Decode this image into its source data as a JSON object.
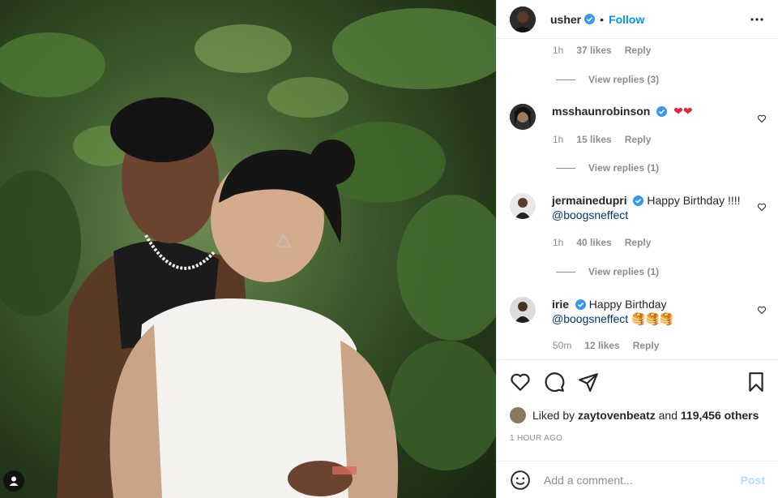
{
  "header": {
    "username": "usher",
    "separator": "•",
    "follow_label": "Follow",
    "more_icon": "more-horizontal-icon"
  },
  "top_comment_meta": {
    "time": "1h",
    "likes": "37 likes",
    "reply": "Reply",
    "view_replies": "View replies (3)"
  },
  "comments": [
    {
      "username": "msshaunrobinson",
      "text": "",
      "emoji": "❤❤",
      "time": "1h",
      "likes": "15 likes",
      "reply": "Reply",
      "view_replies": "View replies (1)"
    },
    {
      "username": "jermainedupri",
      "text": "Happy Birthday !!!!",
      "mention": "@boogsneffect",
      "time": "1h",
      "likes": "40 likes",
      "reply": "Reply",
      "view_replies": "View replies (1)"
    },
    {
      "username": "irie",
      "text": "Happy Birthday",
      "mention": "@boogsneffect",
      "emoji": "🥞🥞🥞",
      "time": "50m",
      "likes": "12 likes",
      "reply": "Reply"
    }
  ],
  "likes": {
    "prefix": "Liked by",
    "user": "zaytovenbeatz",
    "middle": "and",
    "count": "119,456 others"
  },
  "timestamp": "1 HOUR AGO",
  "add_comment": {
    "placeholder": "Add a comment...",
    "post_label": "Post"
  },
  "colors": {
    "accent": "#0095f6",
    "verified": "#3897f0",
    "heart": "#ed4956"
  }
}
